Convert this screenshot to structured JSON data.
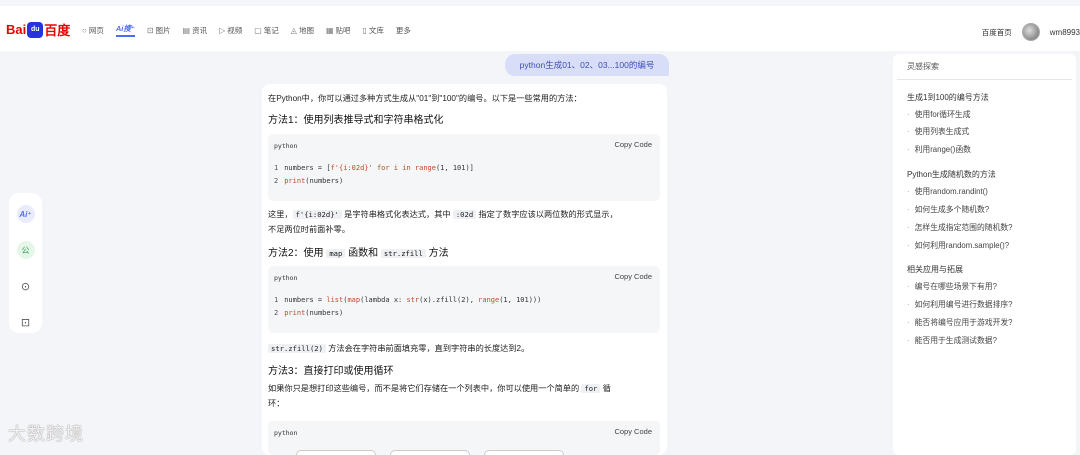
{
  "header": {
    "logo_bai": "Bai",
    "logo_du": "du",
    "logo_cn": "百度",
    "nav": [
      {
        "icon": "search-icon",
        "glyph": "○",
        "label": "网页"
      },
      {
        "icon": "ai-icon",
        "glyph": "",
        "label": "Ai搜⁺"
      },
      {
        "icon": "image-icon",
        "glyph": "⊡",
        "label": "图片"
      },
      {
        "icon": "news-icon",
        "glyph": "▤",
        "label": "资讯"
      },
      {
        "icon": "video-icon",
        "glyph": "▷",
        "label": "视频"
      },
      {
        "icon": "notes-icon",
        "glyph": "▢",
        "label": "笔记"
      },
      {
        "icon": "map-icon",
        "glyph": "◬",
        "label": "地图"
      },
      {
        "icon": "tieba-icon",
        "glyph": "▦",
        "label": "贴吧"
      },
      {
        "icon": "wenku-icon",
        "glyph": "▯",
        "label": "文库"
      },
      {
        "icon": "",
        "glyph": "",
        "label": "更多"
      }
    ],
    "home_link": "百度首页",
    "username": "wm8993"
  },
  "left_toolbar": {
    "ai_label": "Ai⁺",
    "pub_label": "公",
    "history_glyph": "⊙",
    "edit_glyph": "⊡"
  },
  "question": "python生成01、02、03...100的编号",
  "answer": {
    "intro": "在Python中，你可以通过多种方式生成从\"01\"到\"100\"的编号。以下是一些常用的方法：",
    "method1": "方法1：使用列表推导式和字符串格式化",
    "code1": {
      "lang": "python",
      "copy": "Copy Code",
      "line1_no": "1",
      "line1_a": "numbers = [",
      "line1_b": "f'{i:02d}'",
      "line1_c": " for i in ",
      "line1_d": "range",
      "line1_e": "(1, 101)]",
      "line2_no": "2",
      "line2_a": "print",
      "line2_b": "(numbers)"
    },
    "expl1_a": "这里，",
    "expl1_code1": "f'{i:02d}'",
    "expl1_b": " 是字符串格式化表达式，其中 ",
    "expl1_code2": ":02d",
    "expl1_c": " 指定了数字应该以两位数的形式显示，",
    "expl1_line2": "不足两位时前面补零。",
    "method2_a": "方法2：使用 ",
    "method2_code1": "map",
    "method2_b": " 函数和 ",
    "method2_code2": "str.zfill",
    "method2_c": " 方法",
    "code2": {
      "lang": "python",
      "copy": "Copy Code",
      "line1_no": "1",
      "line1_a": "numbers = ",
      "line1_b": "list",
      "line1_c": "(",
      "line1_d": "map",
      "line1_e": "(lambda x: ",
      "line1_f": "str",
      "line1_g": "(x).zfill(2), ",
      "line1_h": "range",
      "line1_i": "(1, 101)))",
      "line2_no": "2",
      "line2_a": "print",
      "line2_b": "(numbers)"
    },
    "expl2_code": "str.zfill(2)",
    "expl2_text": " 方法会在字符串前面填充零，直到字符串的长度达到2。",
    "method3": "方法3：直接打印或使用循环",
    "expl3_a": "如果你只是想打印这些编号，而不是将它们存储在一个列表中，你可以使用一个简单的 ",
    "expl3_code": "for",
    "expl3_b": " 循",
    "expl3_line2": "环：",
    "code3": {
      "lang": "python",
      "copy": "Copy Code"
    }
  },
  "right_panel": {
    "title": "灵感探索",
    "sections": [
      {
        "title": "生成1到100的编号方法",
        "items": [
          "使用for循环生成",
          "使用列表生成式",
          "利用range()函数"
        ]
      },
      {
        "title": "Python生成随机数的方法",
        "items": [
          "使用random.randint()",
          "如何生成多个随机数?",
          "怎样生成指定范围的随机数?",
          "如何利用random.sample()?"
        ]
      },
      {
        "title": "相关应用与拓展",
        "items": [
          "编号在哪些场景下有用?",
          "如何利用编号进行数据排序?",
          "能否将编号应用于游戏开发?",
          "能否用于生成测试数据?"
        ]
      }
    ]
  },
  "watermark": "大数跨境"
}
